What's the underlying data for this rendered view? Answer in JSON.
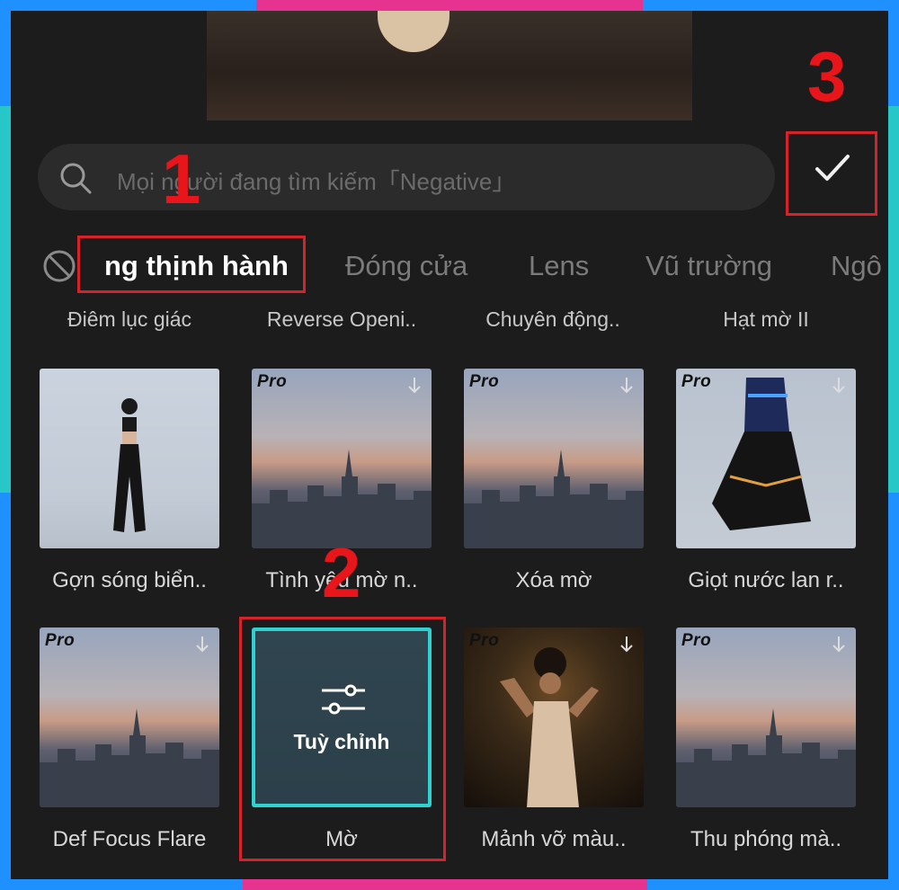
{
  "search": {
    "placeholder": "Mọi người đang tìm kiếm「Negative」"
  },
  "tabs": [
    {
      "label": "ng thịnh hành",
      "active": true
    },
    {
      "label": "Đóng cửa"
    },
    {
      "label": "Lens"
    },
    {
      "label": "Vũ trường"
    },
    {
      "label": "Ngô"
    }
  ],
  "prev_row_labels": [
    "Điêm lục giác",
    "Reverse Openi..",
    "Chuyên động..",
    "Hạt mờ II"
  ],
  "effects": [
    {
      "label": "Gợn sóng biển..",
      "pro": false
    },
    {
      "label": "Tình yêu mờ n..",
      "pro": true
    },
    {
      "label": "Xóa mờ",
      "pro": true
    },
    {
      "label": "Giọt nước lan r..",
      "pro": true
    },
    {
      "label": "Def Focus Flare",
      "pro": true
    },
    {
      "label": "Mờ",
      "pro": false,
      "overlay": "Tuỳ chỉnh"
    },
    {
      "label": "Mảnh vỡ màu..",
      "pro": true
    },
    {
      "label": "Thu phóng mà..",
      "pro": true
    }
  ],
  "pro_badge": "Pro",
  "annotations": [
    "1",
    "2",
    "3"
  ],
  "colors": {
    "highlight": "#d6222a",
    "selection": "#2fd1d1",
    "frame": "#1e90ff"
  }
}
